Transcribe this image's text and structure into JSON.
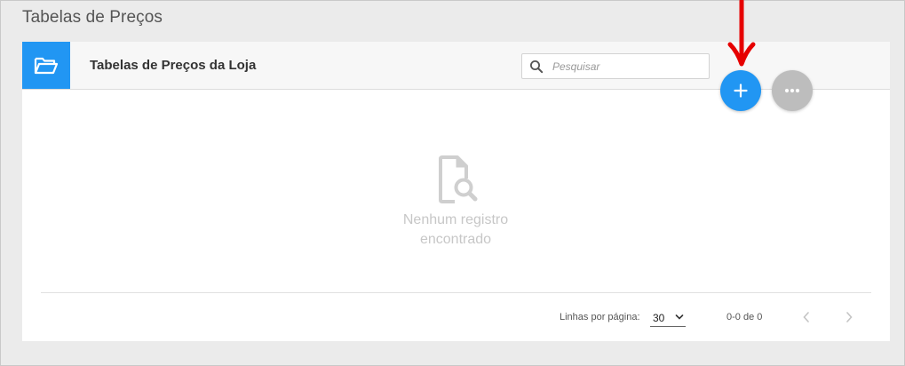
{
  "page": {
    "title": "Tabelas de Preços"
  },
  "card": {
    "title": "Tabelas de Preços da Loja",
    "folder_icon": "folder-open-icon",
    "accent_color": "#2196f3"
  },
  "search": {
    "placeholder": "Pesquisar",
    "value": "",
    "icon": "search-icon"
  },
  "actions": {
    "add_icon": "plus-icon",
    "more_icon": "more-horizontal-icon",
    "add_color": "#2196f3",
    "more_color": "#bdbdbd"
  },
  "annotation": {
    "arrow_color": "#e60000",
    "icon": "red-arrow-down-icon"
  },
  "empty_state": {
    "icon": "file-search-icon",
    "line1": "Nenhum registro",
    "line2": "encontrado"
  },
  "pagination": {
    "rows_label": "Linhas por página:",
    "rows_value": "30",
    "range_text": "0-0 de 0",
    "prev_icon": "chevron-left-icon",
    "next_icon": "chevron-right-icon"
  }
}
